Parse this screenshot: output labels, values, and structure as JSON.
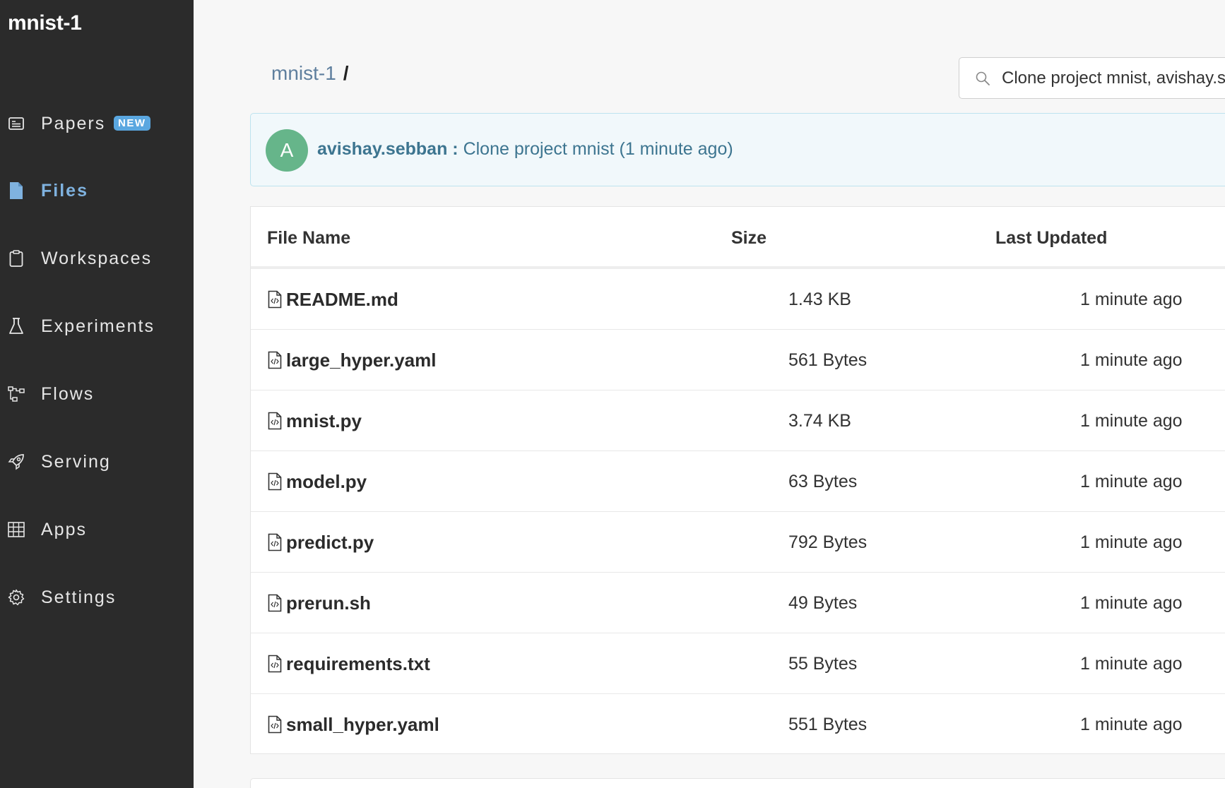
{
  "project": {
    "title": "mnist-1"
  },
  "sidebar": {
    "items": [
      {
        "label": "Papers",
        "icon": "papers-icon",
        "badge": "NEW"
      },
      {
        "label": "Files",
        "icon": "file-icon",
        "active": true
      },
      {
        "label": "Workspaces",
        "icon": "clipboard-icon"
      },
      {
        "label": "Experiments",
        "icon": "flask-icon"
      },
      {
        "label": "Flows",
        "icon": "flow-icon"
      },
      {
        "label": "Serving",
        "icon": "rocket-icon"
      },
      {
        "label": "Apps",
        "icon": "grid-icon"
      },
      {
        "label": "Settings",
        "icon": "gear-icon"
      }
    ]
  },
  "breadcrumb": {
    "project": "mnist-1",
    "separator": "/"
  },
  "search": {
    "value": "Clone project mnist, avishay.sebban"
  },
  "activity": {
    "avatar_letter": "A",
    "user": "avishay.sebban :",
    "message": "Clone project mnist (1 minute ago)"
  },
  "table": {
    "headers": {
      "name": "File Name",
      "size": "Size",
      "updated": "Last Updated"
    },
    "rows": [
      {
        "name": "README.md",
        "size": "1.43 KB",
        "updated": "1 minute ago"
      },
      {
        "name": "large_hyper.yaml",
        "size": "561 Bytes",
        "updated": "1 minute ago"
      },
      {
        "name": "mnist.py",
        "size": "3.74 KB",
        "updated": "1 minute ago"
      },
      {
        "name": "model.py",
        "size": "63 Bytes",
        "updated": "1 minute ago"
      },
      {
        "name": "predict.py",
        "size": "792 Bytes",
        "updated": "1 minute ago"
      },
      {
        "name": "prerun.sh",
        "size": "49 Bytes",
        "updated": "1 minute ago"
      },
      {
        "name": "requirements.txt",
        "size": "55 Bytes",
        "updated": "1 minute ago"
      },
      {
        "name": "small_hyper.yaml",
        "size": "551 Bytes",
        "updated": "1 minute ago"
      }
    ]
  },
  "colors": {
    "sidebar_bg": "#2b2b2b",
    "active_nav": "#7fb2df",
    "badge": "#5aa7e0",
    "avatar": "#66b58a",
    "activity_text": "#3d7590",
    "breadcrumb_link": "#5f7f9e"
  }
}
